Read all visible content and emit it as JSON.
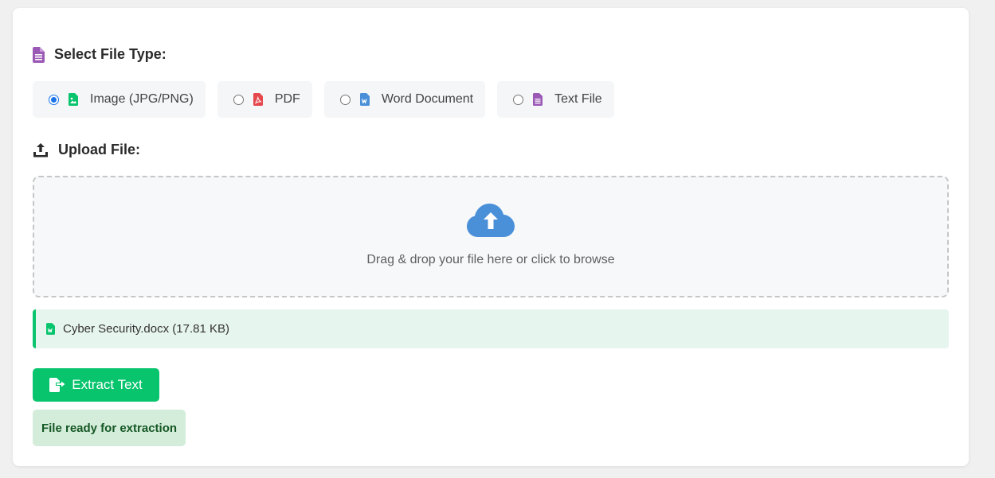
{
  "file_type_section": {
    "title": "Select File Type:",
    "icon": "file-lines-icon",
    "options": [
      {
        "label": "Image (JPG/PNG)",
        "icon": "image-file-icon",
        "color": "#07c46d",
        "checked": true
      },
      {
        "label": "PDF",
        "icon": "pdf-file-icon",
        "color": "#e5484d",
        "checked": false
      },
      {
        "label": "Word Document",
        "icon": "word-file-icon",
        "color": "#4a90d9",
        "checked": false
      },
      {
        "label": "Text File",
        "icon": "text-file-icon",
        "color": "#9b59b6",
        "checked": false
      }
    ]
  },
  "upload_section": {
    "title": "Upload File:",
    "icon": "upload-icon",
    "dropzone": {
      "icon": "cloud-upload-icon",
      "hint": "Drag & drop your file here or click to browse"
    }
  },
  "selected_file": {
    "icon": "word-file-icon",
    "text": "Cyber Security.docx (17.81 KB)"
  },
  "extract_button": {
    "label": "Extract Text",
    "icon": "file-export-icon"
  },
  "status": {
    "text": "File ready for extraction"
  },
  "colors": {
    "accent_green": "#07c46d",
    "accent_blue": "#4a90d9",
    "status_bg": "#d4edda",
    "status_text": "#155724"
  }
}
